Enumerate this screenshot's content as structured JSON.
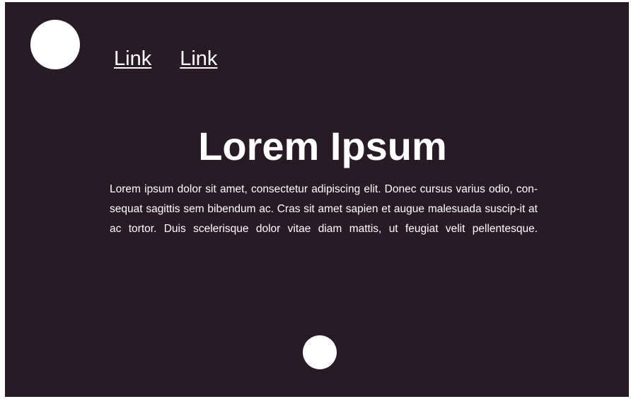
{
  "colors": {
    "background": "#291b26",
    "foreground": "#ffffff"
  },
  "header": {
    "logo_icon": "circle-logo-icon",
    "nav_links": [
      {
        "label": "Link"
      },
      {
        "label": "Link"
      }
    ]
  },
  "hero": {
    "title": "Lorem Ipsum",
    "body": "Lorem ipsum dolor sit amet, consectetur adipiscing elit. Donec cursus varius odio, con-sequat sagittis sem bibendum ac. Cras sit amet sapien et augue malesuada suscip-it at ac tortor. Duis scelerisque dolor vitae diam mattis, ut feugiat velit pellentesque."
  },
  "footer": {
    "scroll_icon": "circle-button-icon"
  }
}
